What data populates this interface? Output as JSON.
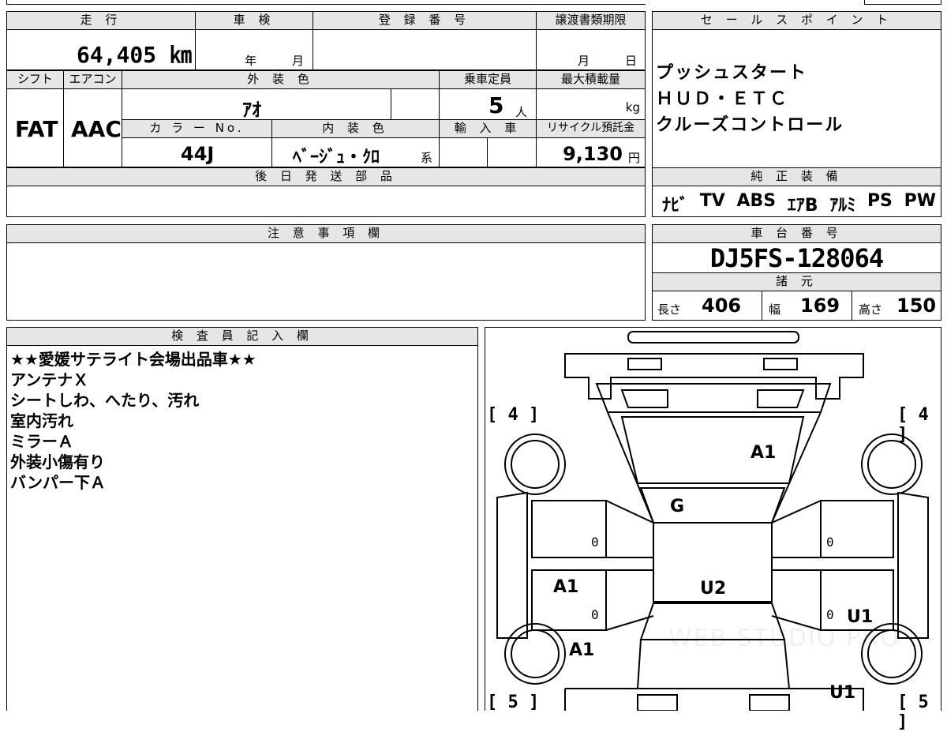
{
  "top_fields": {
    "mileage_header": "走 行",
    "inspection_header": "車 検",
    "registration_header": "登 録 番 号",
    "transfer_deadline_header": "譲渡書類期限",
    "mileage_value": "64,405 ㎞",
    "inspection_year_unit": "年",
    "inspection_month_unit": "月",
    "transfer_month_unit": "月",
    "transfer_day_unit": "日",
    "shift_header": "シフト",
    "aircon_header": "エアコン",
    "exterior_color_header": "外 装 色",
    "capacity_header": "乗車定員",
    "max_load_header": "最大積載量",
    "shift_value": "FAT",
    "aircon_value": "AAC",
    "exterior_color_value": "ｱｵ",
    "capacity_value": "5",
    "capacity_unit": "人",
    "max_load_unit": "kg",
    "color_no_header": "カ ラ ー No.",
    "interior_color_header": "内 装 色",
    "import_header": "輸 入 車",
    "recycle_header": "リサイクル預託金",
    "color_no_value": "44J",
    "interior_color_value": "ﾍﾞｰｼﾞｭ・ｸﾛ",
    "interior_color_suffix": "系",
    "recycle_value": "9,130",
    "recycle_unit": "円",
    "later_parts_header": "後 日 発 送 部 品"
  },
  "sales_points": {
    "header": "セ ー ル ス ポ イ ン ト",
    "lines": [
      "プッシュスタート",
      "ＨＵＤ・ＥＴＣ",
      "クルーズコントロール"
    ]
  },
  "standard_equipment": {
    "header": "純 正 装 備",
    "items": [
      "ﾅﾋﾞ",
      "TV",
      "ABS",
      "ｴｱB",
      "ｱﾙﾐ",
      "PS",
      "PW"
    ]
  },
  "notes": {
    "header": "注 意 事 項 欄"
  },
  "chassis": {
    "header": "車 台 番 号",
    "value": "DJ5FS-128064"
  },
  "specs": {
    "header": "諸 元",
    "length_label": "長さ",
    "length_value": "406",
    "width_label": "幅",
    "width_value": "169",
    "height_label": "高さ",
    "height_value": "150"
  },
  "inspector": {
    "header": "検 査 員 記 入 欄",
    "lines": [
      "★★愛媛サテライト会場出品車★★",
      "アンテナＸ",
      "シートしわ、へたり、汚れ",
      "室内汚れ",
      "ミラーＡ",
      "外装小傷有り",
      "バンパー下Ａ"
    ]
  },
  "car_diagram": {
    "tire_fl": "4",
    "tire_fr": "4",
    "tire_rl": "5",
    "tire_rr": "5",
    "label_windshield": "A1",
    "label_bonnet_rear": "G",
    "label_roof": "U2",
    "label_left_door": "A1",
    "label_left_rear": "A1",
    "label_right_door": "U1",
    "label_right_rear": "U1",
    "zero_1": "0",
    "zero_2": "0",
    "zero_3": "0",
    "zero_4": "0",
    "watermark": "WEB STUDIO PRO"
  }
}
